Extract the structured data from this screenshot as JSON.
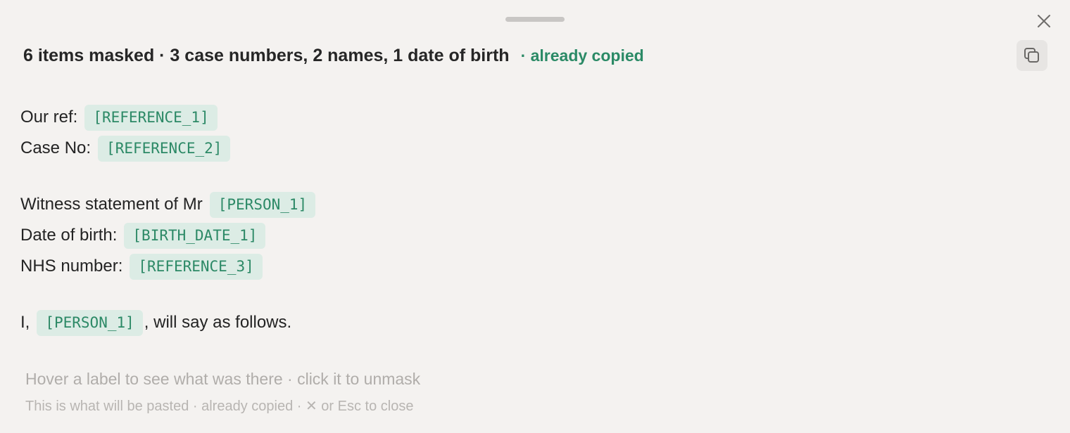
{
  "header": {
    "title": "6 items masked · 3 case numbers, 2 names, 1 date of birth",
    "status": "· already copied"
  },
  "icons": {
    "close": "close-icon",
    "copy": "copy-icon"
  },
  "colors": {
    "accent": "#2b8a66",
    "chip_bg": "#dcece5",
    "background": "#f4f2f0"
  },
  "document": {
    "lines": [
      {
        "label": "Our ref:",
        "chip": "[REFERENCE_1]"
      },
      {
        "label": "Case No:",
        "chip": "[REFERENCE_2]"
      },
      {
        "label": "Witness statement of Mr",
        "chip": "[PERSON_1]"
      },
      {
        "label": "Date of birth:",
        "chip": "[BIRTH_DATE_1]"
      },
      {
        "label": "NHS number:",
        "chip": "[REFERENCE_3]"
      },
      {
        "label": "I,",
        "chip": "[PERSON_1]",
        "suffix": ", will say as follows."
      }
    ]
  },
  "footer": {
    "hint_primary": "Hover a label to see what was there · click it to unmask",
    "hint_secondary": "This is what will be pasted · already copied · ✕ or Esc to close"
  }
}
